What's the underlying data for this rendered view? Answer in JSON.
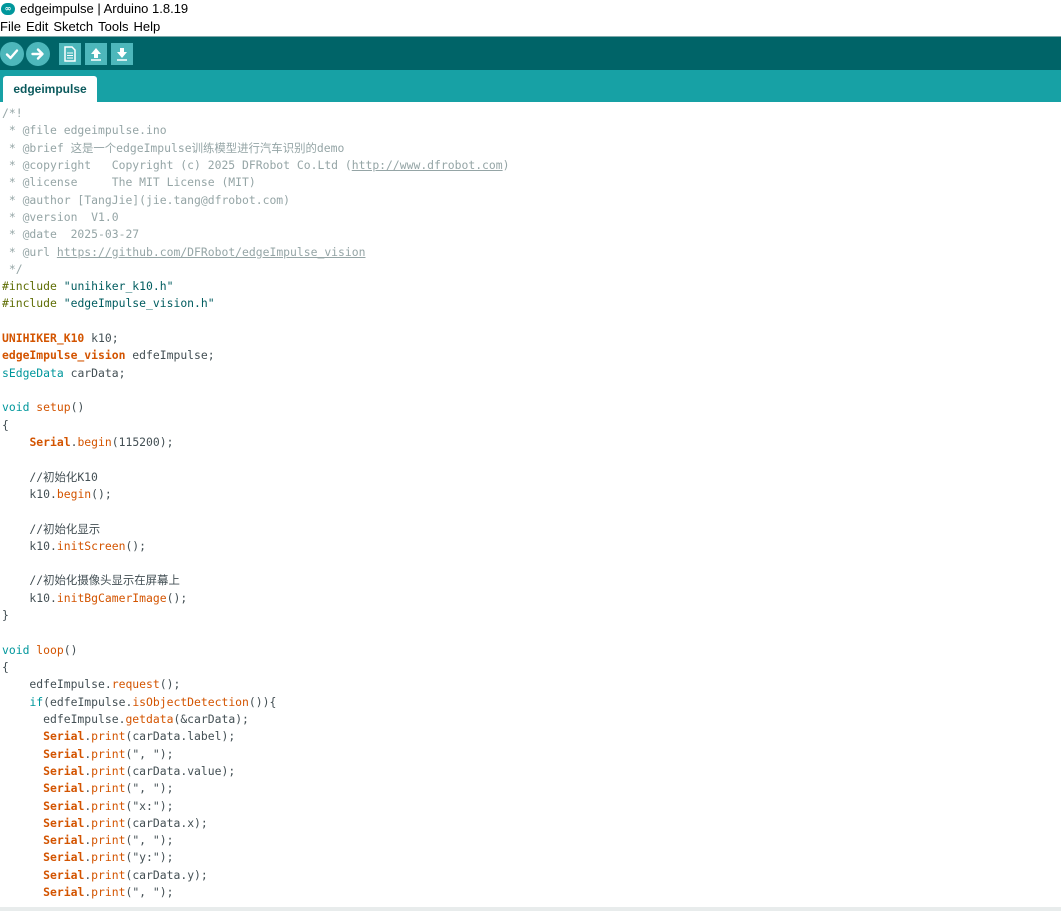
{
  "window": {
    "title": "edgeimpulse | Arduino 1.8.19",
    "logo_symbol": "∞"
  },
  "menu": [
    "File",
    "Edit",
    "Sketch",
    "Tools",
    "Help"
  ],
  "toolbar": {
    "buttons": [
      {
        "name": "verify-button",
        "icon": "check-icon",
        "symbol": "✓"
      },
      {
        "name": "upload-button",
        "icon": "arrow-right-icon",
        "symbol": "➜"
      },
      {
        "name": "new-button",
        "icon": "new-file-icon",
        "symbol": "▯"
      },
      {
        "name": "open-button",
        "icon": "arrow-up-icon",
        "symbol": "⬆"
      },
      {
        "name": "save-button",
        "icon": "arrow-down-icon",
        "symbol": "⬇"
      }
    ]
  },
  "tabs": [
    {
      "label": "edgeimpulse",
      "active": true
    }
  ],
  "colors": {
    "toolbar": "#006468",
    "tabbar": "#17a1a5",
    "toolbar_button": "#4db7bb",
    "comment": "#95a5a6",
    "keyword": "#00979c",
    "library": "#d35400",
    "preprocessor": "#5e6d03",
    "string": "#005c5f",
    "text": "#434f54"
  },
  "code_lines": [
    [
      [
        "comment",
        "/*!"
      ]
    ],
    [
      [
        "comment",
        " * @file edgeimpulse.ino"
      ]
    ],
    [
      [
        "comment",
        " * @brief 这是一个edgeImpulse训练模型进行汽车识别的demo"
      ]
    ],
    [
      [
        "comment",
        " * @copyright   Copyright (c) 2025 DFRobot Co.Ltd ("
      ],
      [
        "link",
        "http://www.dfrobot.com"
      ],
      [
        "comment",
        ")"
      ]
    ],
    [
      [
        "comment",
        " * @license     The MIT License (MIT)"
      ]
    ],
    [
      [
        "comment",
        " * @author [TangJie](jie.tang@dfrobot.com)"
      ]
    ],
    [
      [
        "comment",
        " * @version  V1.0"
      ]
    ],
    [
      [
        "comment",
        " * @date  2025-03-27"
      ]
    ],
    [
      [
        "comment",
        " * @url "
      ],
      [
        "link",
        "https://github.com/DFRobot/edgeImpulse_vision"
      ]
    ],
    [
      [
        "comment",
        " */"
      ]
    ],
    [
      [
        "preproc",
        "#include "
      ],
      [
        "string",
        "\"unihiker_k10.h\""
      ]
    ],
    [
      [
        "preproc",
        "#include "
      ],
      [
        "string",
        "\"edgeImpulse_vision.h\""
      ]
    ],
    [],
    [
      [
        "lib",
        "UNIHIKER_K10"
      ],
      [
        "plain",
        " k10;"
      ]
    ],
    [
      [
        "lib",
        "edgeImpulse_vision"
      ],
      [
        "plain",
        " edfeImpulse;"
      ]
    ],
    [
      [
        "keyword",
        "sEdgeData"
      ],
      [
        "plain",
        " carData;"
      ]
    ],
    [],
    [
      [
        "keyword",
        "void"
      ],
      [
        "plain",
        " "
      ],
      [
        "func",
        "setup"
      ],
      [
        "plain",
        "()"
      ]
    ],
    [
      [
        "plain",
        "{"
      ]
    ],
    [
      [
        "plain",
        "    "
      ],
      [
        "lib",
        "Serial"
      ],
      [
        "plain",
        "."
      ],
      [
        "func",
        "begin"
      ],
      [
        "plain",
        "(115200);"
      ]
    ],
    [],
    [
      [
        "plain",
        "    //初始化K10"
      ]
    ],
    [
      [
        "plain",
        "    k10."
      ],
      [
        "func",
        "begin"
      ],
      [
        "plain",
        "();"
      ]
    ],
    [],
    [
      [
        "plain",
        "    //初始化显示"
      ]
    ],
    [
      [
        "plain",
        "    k10."
      ],
      [
        "func",
        "initScreen"
      ],
      [
        "plain",
        "();"
      ]
    ],
    [],
    [
      [
        "plain",
        "    //初始化摄像头显示在屏幕上"
      ]
    ],
    [
      [
        "plain",
        "    k10."
      ],
      [
        "func",
        "initBgCamerImage"
      ],
      [
        "plain",
        "();"
      ]
    ],
    [
      [
        "plain",
        "}"
      ]
    ],
    [],
    [
      [
        "keyword",
        "void"
      ],
      [
        "plain",
        " "
      ],
      [
        "func",
        "loop"
      ],
      [
        "plain",
        "()"
      ]
    ],
    [
      [
        "plain",
        "{"
      ]
    ],
    [
      [
        "plain",
        "    edfeImpulse."
      ],
      [
        "func",
        "request"
      ],
      [
        "plain",
        "();"
      ]
    ],
    [
      [
        "plain",
        "    "
      ],
      [
        "keyword",
        "if"
      ],
      [
        "plain",
        "(edfeImpulse."
      ],
      [
        "func",
        "isObjectDetection"
      ],
      [
        "plain",
        "()){"
      ]
    ],
    [
      [
        "plain",
        "      edfeImpulse."
      ],
      [
        "func",
        "getdata"
      ],
      [
        "plain",
        "(&carData);"
      ]
    ],
    [
      [
        "plain",
        "      "
      ],
      [
        "lib",
        "Serial"
      ],
      [
        "plain",
        "."
      ],
      [
        "func",
        "print"
      ],
      [
        "plain",
        "(carData.label);"
      ]
    ],
    [
      [
        "plain",
        "      "
      ],
      [
        "lib",
        "Serial"
      ],
      [
        "plain",
        "."
      ],
      [
        "func",
        "print"
      ],
      [
        "plain",
        "(\", \");"
      ]
    ],
    [
      [
        "plain",
        "      "
      ],
      [
        "lib",
        "Serial"
      ],
      [
        "plain",
        "."
      ],
      [
        "func",
        "print"
      ],
      [
        "plain",
        "(carData.value);"
      ]
    ],
    [
      [
        "plain",
        "      "
      ],
      [
        "lib",
        "Serial"
      ],
      [
        "plain",
        "."
      ],
      [
        "func",
        "print"
      ],
      [
        "plain",
        "(\", \");"
      ]
    ],
    [
      [
        "plain",
        "      "
      ],
      [
        "lib",
        "Serial"
      ],
      [
        "plain",
        "."
      ],
      [
        "func",
        "print"
      ],
      [
        "plain",
        "(\"x:\");"
      ]
    ],
    [
      [
        "plain",
        "      "
      ],
      [
        "lib",
        "Serial"
      ],
      [
        "plain",
        "."
      ],
      [
        "func",
        "print"
      ],
      [
        "plain",
        "(carData.x);"
      ]
    ],
    [
      [
        "plain",
        "      "
      ],
      [
        "lib",
        "Serial"
      ],
      [
        "plain",
        "."
      ],
      [
        "func",
        "print"
      ],
      [
        "plain",
        "(\", \");"
      ]
    ],
    [
      [
        "plain",
        "      "
      ],
      [
        "lib",
        "Serial"
      ],
      [
        "plain",
        "."
      ],
      [
        "func",
        "print"
      ],
      [
        "plain",
        "(\"y:\");"
      ]
    ],
    [
      [
        "plain",
        "      "
      ],
      [
        "lib",
        "Serial"
      ],
      [
        "plain",
        "."
      ],
      [
        "func",
        "print"
      ],
      [
        "plain",
        "(carData.y);"
      ]
    ],
    [
      [
        "plain",
        "      "
      ],
      [
        "lib",
        "Serial"
      ],
      [
        "plain",
        "."
      ],
      [
        "func",
        "print"
      ],
      [
        "plain",
        "(\", \");"
      ]
    ]
  ]
}
